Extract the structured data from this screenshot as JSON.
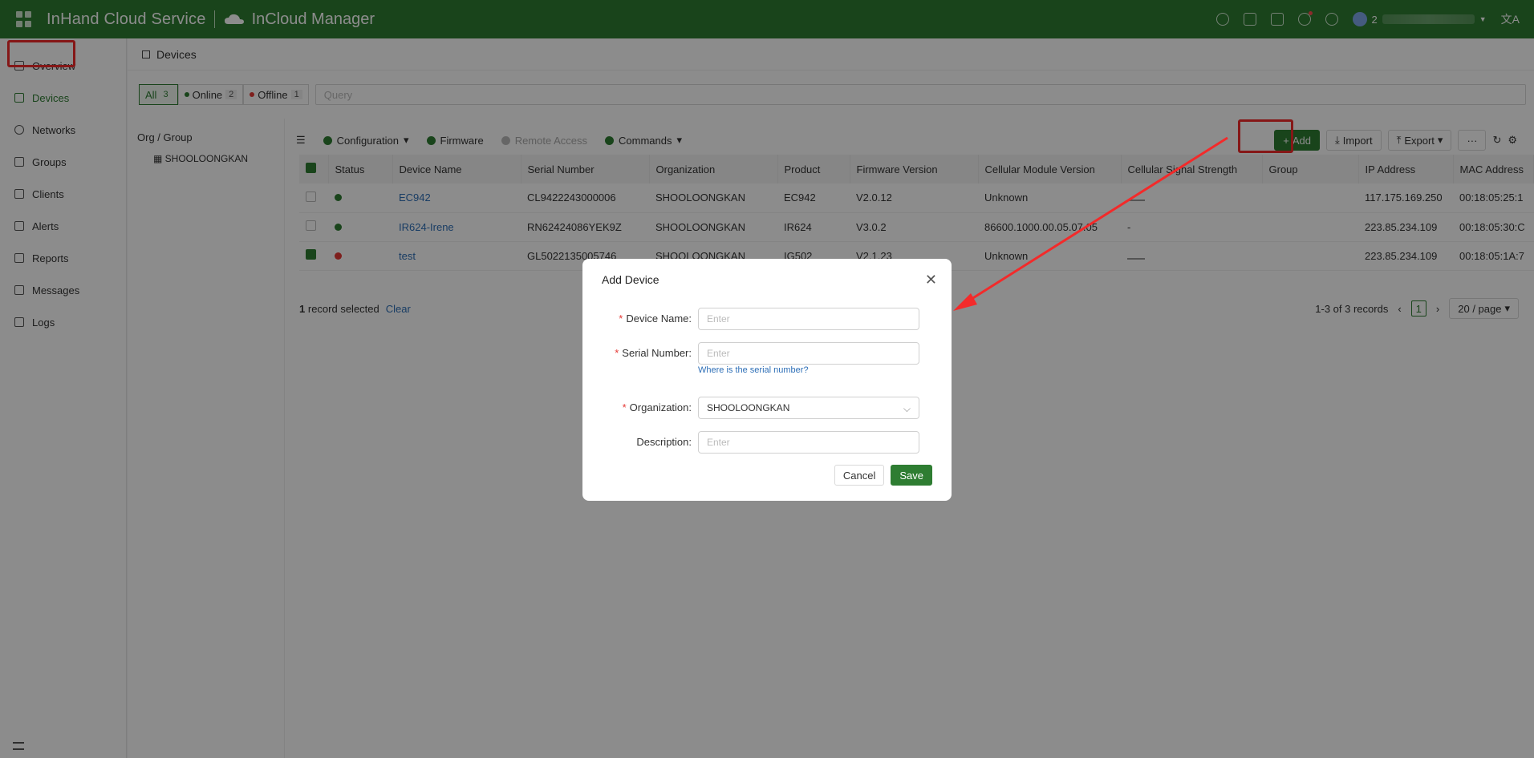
{
  "header": {
    "brand": "InHand Cloud Service",
    "product": "InCloud Manager",
    "user_prefix": "2"
  },
  "sidebar": {
    "items": [
      {
        "label": "Overview"
      },
      {
        "label": "Devices"
      },
      {
        "label": "Networks"
      },
      {
        "label": "Groups"
      },
      {
        "label": "Clients"
      },
      {
        "label": "Alerts"
      },
      {
        "label": "Reports"
      },
      {
        "label": "Messages"
      },
      {
        "label": "Logs"
      }
    ]
  },
  "page": {
    "title": "Devices"
  },
  "filters": {
    "all_label": "All",
    "all_count": "3",
    "online_label": "Online",
    "online_count": "2",
    "offline_label": "Offline",
    "offline_count": "1",
    "query_placeholder": "Query"
  },
  "org": {
    "title": "Org / Group",
    "node": "SHOOLOONGKAN"
  },
  "toolbar": {
    "configuration": "Configuration",
    "firmware": "Firmware",
    "remote_access": "Remote Access",
    "commands": "Commands",
    "add": "Add",
    "import": "Import",
    "export": "Export",
    "more": "···"
  },
  "table": {
    "columns": [
      "Status",
      "Device Name",
      "Serial Number",
      "Organization",
      "Product",
      "Firmware Version",
      "Cellular Module Version",
      "Cellular Signal Strength",
      "Group",
      "IP Address",
      "MAC Address"
    ],
    "rows": [
      {
        "name": "EC942",
        "serial": "CL9422243000006",
        "org": "SHOOLOONGKAN",
        "product": "EC942",
        "fw": "V2.0.12",
        "module": "Unknown",
        "signal": "",
        "group": "",
        "ip": "117.175.169.250",
        "mac": "00:18:05:25:1",
        "status": "online",
        "checked": false
      },
      {
        "name": "IR624-Irene",
        "serial": "RN62424086YEK9Z",
        "org": "SHOOLOONGKAN",
        "product": "IR624",
        "fw": "V3.0.2",
        "module": "86600.1000.00.05.07.05",
        "signal": "-",
        "group": "",
        "ip": "223.85.234.109",
        "mac": "00:18:05:30:C",
        "status": "online",
        "checked": false
      },
      {
        "name": "test",
        "serial": "GL5022135005746",
        "org": "SHOOLOONGKAN",
        "product": "IG502",
        "fw": "V2.1.23",
        "module": "Unknown",
        "signal": "",
        "group": "",
        "ip": "223.85.234.109",
        "mac": "00:18:05:1A:7",
        "status": "offline",
        "checked": true
      }
    ]
  },
  "footer": {
    "selected_count": "1",
    "selected_text": "record selected",
    "clear": "Clear",
    "records": "1-3 of 3 records",
    "page": "1",
    "page_size": "20 / page"
  },
  "modal": {
    "title": "Add Device",
    "device_name_label": "Device Name:",
    "device_name_placeholder": "Enter",
    "serial_label": "Serial Number:",
    "serial_placeholder": "Enter",
    "serial_help": "Where is the serial number?",
    "org_label": "Organization:",
    "org_value": "SHOOLOONGKAN",
    "desc_label": "Description:",
    "desc_placeholder": "Enter",
    "cancel": "Cancel",
    "save": "Save"
  },
  "colors": {
    "brand_green": "#2e7d32",
    "annotation_red": "#f32a2a"
  }
}
